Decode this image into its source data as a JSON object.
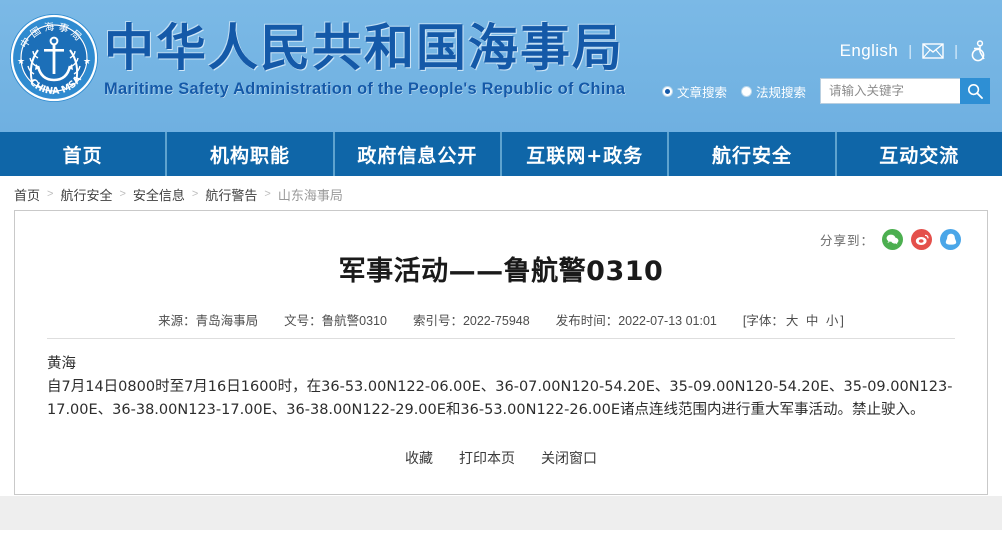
{
  "header": {
    "emblem": {
      "name": "china-msa-emblem",
      "arc_text": "中国海事局",
      "bottom_text": "CHINA MSA"
    },
    "site_title_cn": "中华人民共和国海事局",
    "site_title_en": "Maritime Safety Administration of the People's Republic of China",
    "utility": {
      "english_label": "English",
      "separator": "|",
      "mail_icon": "mail-icon",
      "accessibility_icon": "accessibility-icon"
    },
    "search": {
      "radios": [
        {
          "label": "文章搜索",
          "checked": true
        },
        {
          "label": "法规搜索",
          "checked": false
        }
      ],
      "placeholder": "请输入关键字",
      "value": "",
      "button_icon": "search-icon"
    }
  },
  "nav": {
    "items": [
      {
        "label": "首页"
      },
      {
        "label": "机构职能"
      },
      {
        "label": "政府信息公开"
      },
      {
        "label": "互联网+政务"
      },
      {
        "label": "航行安全"
      },
      {
        "label": "互动交流"
      }
    ]
  },
  "breadcrumb": {
    "items": [
      "首页",
      "航行安全",
      "安全信息",
      "航行警告",
      "山东海事局"
    ],
    "separator": ">"
  },
  "article": {
    "share": {
      "label": "分享到：",
      "targets": [
        {
          "name": "wechat-share-icon",
          "color": "#4caf50"
        },
        {
          "name": "weibo-share-icon",
          "color": "#e4504b"
        },
        {
          "name": "qq-share-icon",
          "color": "#4aa6e8"
        }
      ]
    },
    "title": "军事活动——鲁航警0310",
    "meta": {
      "source": "来源：青岛海事局",
      "doc_number": "文号：鲁航警0310",
      "index_number": "索引号：2022-75948",
      "publish_time": "发布时间：2022-07-13 01:01",
      "font_prefix": "[字体：",
      "font_large": "大",
      "font_medium": "中",
      "font_small": "小",
      "font_suffix": "]"
    },
    "body": {
      "line1": "黄海",
      "line2": "自7月14日0800时至7月16日1600时，在36-53.00N122-06.00E、36-07.00N120-54.20E、35-09.00N120-54.20E、35-09.00N123-17.00E、36-38.00N123-17.00E、36-38.00N122-29.00E和36-53.00N122-26.00E诸点连线范围内进行重大军事活动。禁止驶入。"
    },
    "actions": [
      {
        "label": "收藏",
        "name": "favorite-link"
      },
      {
        "label": "打印本页",
        "name": "print-page-link"
      },
      {
        "label": "关闭窗口",
        "name": "close-window-link"
      }
    ]
  },
  "colors": {
    "header_bg": "#74b4e3",
    "nav_bg": "#0f66a8",
    "title_blue": "#1459a8",
    "search_btn": "#2e8fd4"
  }
}
